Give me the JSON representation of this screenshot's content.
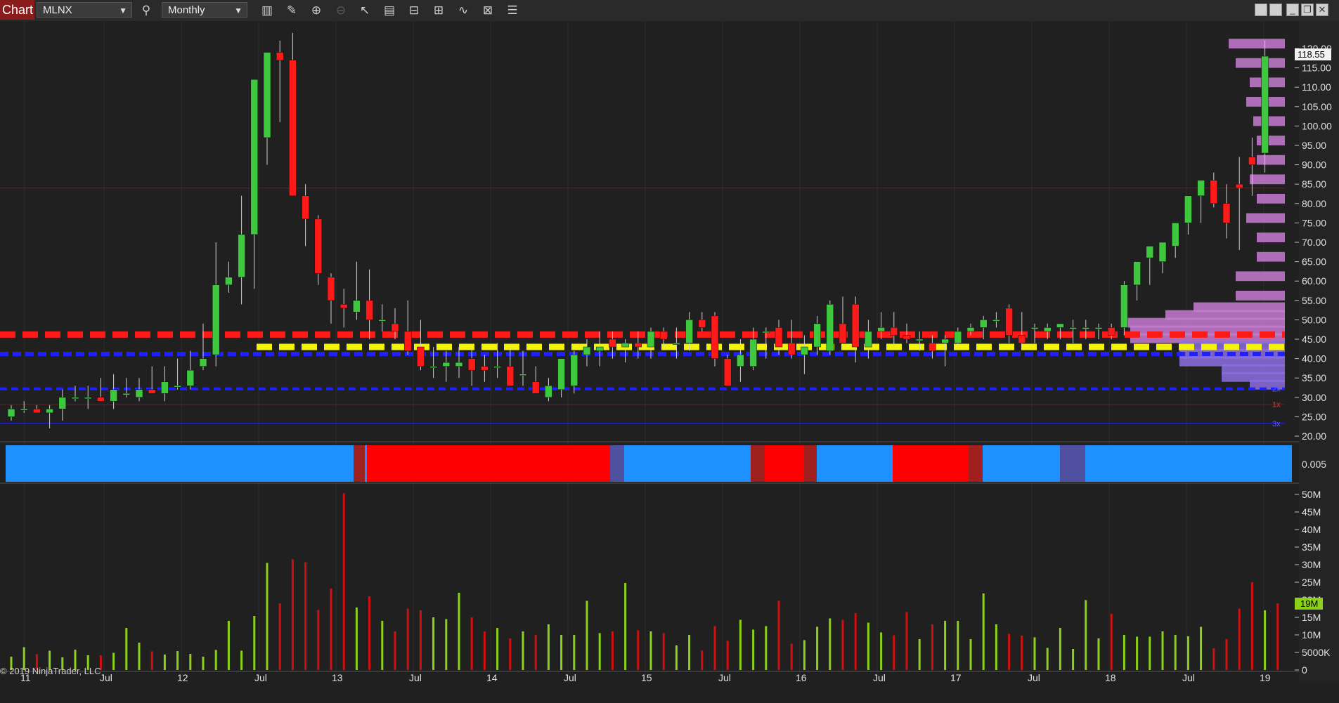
{
  "toolbar": {
    "tab_label": "Chart",
    "symbol": "MLNX",
    "interval": "Monthly",
    "icons": [
      "search-icon",
      "bar-type-icon",
      "pencil-icon",
      "zoom-in-icon",
      "zoom-out-icon",
      "cursor-icon",
      "data-box-icon",
      "properties-icon",
      "strategies-icon",
      "indicators-icon",
      "instrument-icon",
      "menu-icon"
    ],
    "window_icons": [
      "restore-icon",
      "maximize-icon",
      "minimize-icon",
      "window-icon",
      "close-icon"
    ]
  },
  "price_panel": {
    "last_price": "118.55",
    "y_ticks": [
      "120.00",
      "115.00",
      "110.00",
      "105.00",
      "100.00",
      "95.00",
      "90.00",
      "85.00",
      "80.00",
      "75.00",
      "70.00",
      "65.00",
      "60.00",
      "55.00",
      "50.00",
      "45.00",
      "40.00",
      "35.00",
      "30.00",
      "25.00",
      "20.00"
    ],
    "level_tags": [
      "2x",
      "1x",
      "3x"
    ]
  },
  "indicator_panel": {
    "value_label": "0.005"
  },
  "volume_panel": {
    "y_ticks": [
      "50M",
      "45M",
      "40M",
      "35M",
      "30M",
      "25M",
      "20M",
      "15M",
      "10M",
      "5000K",
      "0"
    ],
    "last_volume": "19M"
  },
  "x_axis": {
    "labels": [
      "11",
      "Jul",
      "12",
      "Jul",
      "13",
      "Jul",
      "14",
      "Jul",
      "15",
      "Jul",
      "16",
      "Jul",
      "17",
      "Jul",
      "18",
      "Jul",
      "19"
    ]
  },
  "copyright": "© 2019 NinjaTrader, LLC",
  "colors": {
    "up": "#3ec83e",
    "down": "#ff1a1a",
    "vol_up": "#8bd11a",
    "vol_down": "#d10f0f",
    "resistance": "#ff1a1a",
    "support": "#f2f20a",
    "blue_level": "#2020ff",
    "indicator_blue": "#1e90ff",
    "indicator_red": "#ff0000",
    "profile": "#c77dd2"
  },
  "chart_data": [
    {
      "type": "candlestick",
      "title": "MLNX",
      "interval": "Monthly",
      "x": [
        "2011-01",
        "2011-02",
        "2011-03",
        "2011-04",
        "2011-05",
        "2011-06",
        "2011-07",
        "2011-08",
        "2011-09",
        "2011-10",
        "2011-11",
        "2011-12",
        "2012-01",
        "2012-02",
        "2012-03",
        "2012-04",
        "2012-05",
        "2012-06",
        "2012-07",
        "2012-08",
        "2012-09",
        "2012-10",
        "2012-11",
        "2012-12",
        "2013-01",
        "2013-02",
        "2013-03",
        "2013-04",
        "2013-05",
        "2013-06",
        "2013-07",
        "2013-08",
        "2013-09",
        "2013-10",
        "2013-11",
        "2013-12",
        "2014-01",
        "2014-02",
        "2014-03",
        "2014-04",
        "2014-05",
        "2014-06",
        "2014-07",
        "2014-08",
        "2014-09",
        "2014-10",
        "2014-11",
        "2014-12",
        "2015-01",
        "2015-02",
        "2015-03",
        "2015-04",
        "2015-05",
        "2015-06",
        "2015-07",
        "2015-08",
        "2015-09",
        "2015-10",
        "2015-11",
        "2015-12",
        "2016-01",
        "2016-02",
        "2016-03",
        "2016-04",
        "2016-05",
        "2016-06",
        "2016-07",
        "2016-08",
        "2016-09",
        "2016-10",
        "2016-11",
        "2016-12",
        "2017-01",
        "2017-02",
        "2017-03",
        "2017-04",
        "2017-05",
        "2017-06",
        "2017-07",
        "2017-08",
        "2017-09",
        "2017-10",
        "2017-11",
        "2017-12",
        "2018-01",
        "2018-02",
        "2018-03",
        "2018-04",
        "2018-05",
        "2018-06",
        "2018-07",
        "2018-08",
        "2018-09",
        "2018-10",
        "2018-11",
        "2018-12",
        "2019-01",
        "2019-02",
        "2019-03"
      ],
      "open": [
        25,
        27,
        27,
        26,
        27,
        30,
        30,
        30,
        29,
        31,
        30,
        32,
        31,
        33,
        33,
        38,
        41,
        59,
        61,
        72,
        97,
        119,
        117,
        82,
        76,
        61,
        54,
        52,
        55,
        50,
        49,
        47,
        43,
        38,
        38,
        38,
        40,
        38,
        38,
        38,
        36,
        34,
        30,
        32,
        33,
        41,
        42,
        45,
        43,
        44,
        43,
        47,
        44,
        44,
        50,
        51,
        40,
        38,
        38,
        47,
        48,
        44,
        41,
        43,
        42,
        49,
        54,
        43,
        47,
        48,
        46,
        45,
        44,
        44,
        44,
        47,
        48,
        50,
        53,
        46,
        48,
        47,
        48,
        48,
        48,
        48,
        48,
        48,
        59,
        66,
        65,
        69,
        75,
        82,
        86,
        80,
        85,
        92,
        93
      ],
      "high": [
        28,
        29,
        28,
        28,
        32,
        33,
        33,
        35,
        36,
        35,
        35,
        38,
        38,
        40,
        42,
        49,
        70,
        65,
        82,
        112,
        119,
        122,
        124,
        85,
        77,
        62,
        58,
        65,
        63,
        54,
        53,
        55,
        50,
        43,
        42,
        43,
        43,
        41,
        44,
        43,
        42,
        38,
        35,
        39,
        42,
        45,
        47,
        47,
        45,
        47,
        48,
        48,
        48,
        52,
        52,
        52,
        41,
        45,
        48,
        48,
        50,
        50,
        46,
        51,
        55,
        56,
        56,
        50,
        52,
        52,
        49,
        47,
        46,
        46,
        48,
        49,
        51,
        52,
        54,
        52,
        49,
        49,
        49,
        50,
        50,
        49,
        49,
        60,
        64,
        68,
        70,
        75,
        80,
        86,
        88,
        85,
        92,
        97,
        122
      ],
      "low": [
        24,
        26,
        26,
        22,
        24,
        29,
        27,
        29,
        27,
        30,
        29,
        31,
        29,
        32,
        32,
        37,
        38,
        57,
        54,
        58,
        90,
        101,
        95,
        69,
        59,
        49,
        48,
        50,
        45,
        47,
        45,
        41,
        37,
        35,
        34,
        35,
        33,
        34,
        35,
        36,
        33,
        31,
        29,
        30,
        31,
        38,
        38,
        40,
        39,
        40,
        40,
        43,
        40,
        42,
        47,
        38,
        33,
        34,
        37,
        40,
        41,
        40,
        36,
        41,
        41,
        46,
        39,
        40,
        45,
        43,
        44,
        42,
        40,
        38,
        43,
        46,
        45,
        48,
        44,
        43,
        44,
        45,
        45,
        44,
        45,
        45,
        45,
        46,
        55,
        59,
        62,
        66,
        72,
        75,
        79,
        71,
        68,
        82,
        88
      ],
      "close": [
        27,
        27,
        26,
        27,
        30,
        30,
        30,
        29,
        32,
        31,
        32,
        31,
        34,
        33,
        37,
        40,
        59,
        61,
        72,
        112,
        119,
        117,
        82,
        76,
        62,
        55,
        53,
        55,
        50,
        50,
        47,
        42,
        38,
        38,
        39,
        39,
        37,
        37,
        38,
        33,
        36,
        31,
        33,
        40,
        41,
        43,
        43,
        43,
        44,
        43,
        47,
        45,
        44,
        50,
        48,
        40,
        33,
        41,
        45,
        47,
        43,
        41,
        43,
        49,
        54,
        44,
        43,
        47,
        48,
        46,
        45,
        45,
        42,
        45,
        47,
        48,
        50,
        50,
        46,
        44,
        48,
        48,
        49,
        48,
        48,
        48,
        46,
        59,
        65,
        69,
        70,
        75,
        82,
        86,
        80,
        75,
        84,
        90,
        118
      ]
    },
    {
      "type": "bar",
      "title": "Volume",
      "values_millions": [
        3.8,
        6.5,
        4.5,
        5.5,
        3.6,
        5.8,
        4.2,
        4.2,
        4.9,
        12,
        7.8,
        5.3,
        4.4,
        5.4,
        4.6,
        3.8,
        5.7,
        14,
        5.5,
        15.4,
        30.5,
        19,
        31.5,
        30.7,
        17.1,
        23.2,
        50.3,
        17.8,
        21,
        14,
        11,
        17.5,
        17,
        15,
        14.5,
        22,
        15,
        11,
        12,
        9,
        11,
        10,
        13,
        10,
        10,
        19.7,
        10.5,
        11,
        24.8,
        11.3,
        11,
        10.5,
        7,
        10,
        5.5,
        12.5,
        8.3,
        14.3,
        11.5,
        12.5,
        19.7,
        7.5,
        8.5,
        12.3,
        14.7,
        14.3,
        16.2,
        13.5,
        10.7,
        9.9,
        16.5,
        8.8,
        13,
        14,
        14,
        8.8,
        21.8,
        13,
        10.3,
        9.8,
        9.3,
        6.3,
        12,
        6,
        19.9,
        9,
        16,
        10,
        9.5,
        9.5,
        11,
        10,
        9.6,
        12.3,
        6.2,
        8.8,
        17.5,
        25,
        17,
        19
      ],
      "ylim": [
        0,
        50
      ]
    },
    {
      "type": "horizontal_levels",
      "levels": [
        {
          "name": "resistance",
          "value": 46.2,
          "color": "#ff1a1a"
        },
        {
          "name": "support",
          "value": 43,
          "color": "#f2f20a"
        },
        {
          "name": "blue_upper",
          "value": 41.2,
          "color": "#2020ff"
        },
        {
          "name": "blue_lower",
          "value": 32.2,
          "color": "#2020ff"
        },
        {
          "name": "thin_red",
          "value": 84,
          "color": "#8a1010"
        },
        {
          "name": "thin_red_low",
          "value": 28.2,
          "color": "#8a1010"
        },
        {
          "name": "thin_blue_low",
          "value": 23.3,
          "color": "#2020ff"
        }
      ],
      "ylim": [
        18.5,
        122
      ]
    }
  ]
}
